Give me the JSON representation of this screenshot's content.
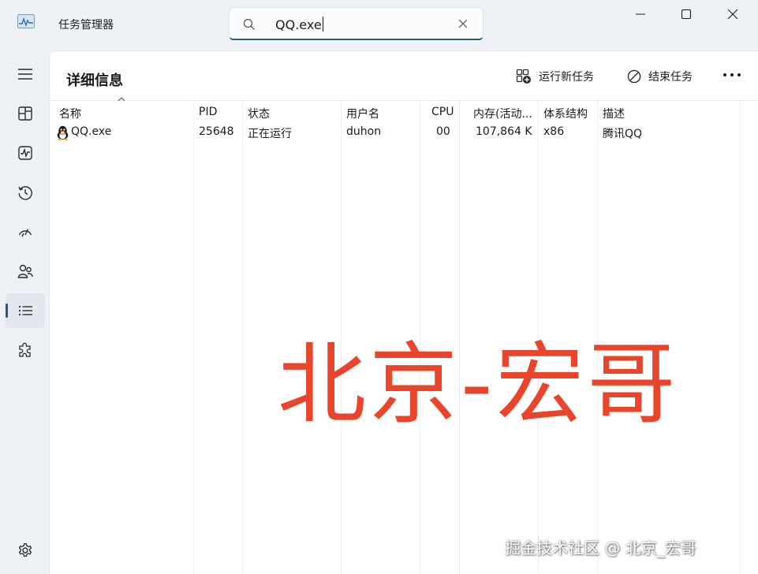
{
  "window": {
    "title": "任务管理器",
    "app_icon": "task-manager-icon",
    "search": {
      "value": "QQ.exe",
      "icon": "search-icon",
      "clear_icon": "close-icon"
    },
    "controls": {
      "minimize": "minimize-icon",
      "maximize": "maximize-icon",
      "close": "close-icon"
    }
  },
  "sidebar": {
    "menu_icon": "hamburger-icon",
    "items": [
      {
        "id": "processes",
        "icon": "processes-icon"
      },
      {
        "id": "performance",
        "icon": "performance-icon"
      },
      {
        "id": "app-history",
        "icon": "history-icon"
      },
      {
        "id": "startup-apps",
        "icon": "speedometer-icon"
      },
      {
        "id": "users",
        "icon": "users-icon"
      },
      {
        "id": "details",
        "icon": "list-icon",
        "active": true
      },
      {
        "id": "services",
        "icon": "puzzle-icon"
      }
    ],
    "settings_icon": "gear-icon"
  },
  "main": {
    "title": "详细信息",
    "commands": {
      "run_new_task": "运行新任务",
      "end_task": "结束任务",
      "more": "more-icon"
    },
    "table": {
      "columns": [
        "名称",
        "PID",
        "状态",
        "用户名",
        "CPU",
        "内存(活动...",
        "体系结构",
        "描述"
      ],
      "sort_column": "名称",
      "rows": [
        {
          "icon": "qq-penguin-icon",
          "name": "QQ.exe",
          "pid": "25648",
          "status": "正在运行",
          "user": "duhon",
          "cpu": "00",
          "memory": "107,864 K",
          "arch": "x86",
          "description": "腾讯QQ"
        }
      ]
    }
  },
  "watermark": {
    "large_text": "北京-宏哥",
    "large_color": "#e8452c",
    "small_text": "掘金技术社区 @ 北京_宏哥"
  },
  "colors": {
    "accent": "#1f5d7a",
    "background": "#eef1f6",
    "panel": "#ffffff"
  }
}
